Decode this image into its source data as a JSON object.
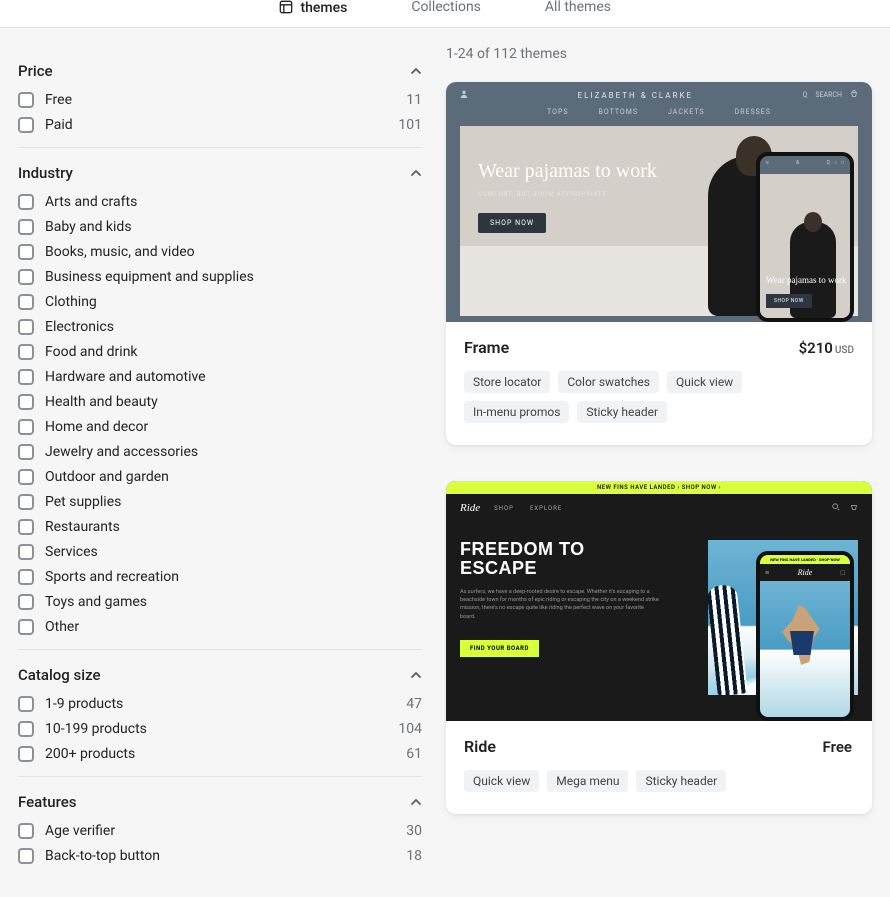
{
  "nav": {
    "themes": "themes",
    "collections": "Collections",
    "all": "All themes"
  },
  "result_count_text": "1-24 of 112 themes",
  "filters": {
    "price": {
      "title": "Price",
      "options": [
        {
          "label": "Free",
          "count": "11"
        },
        {
          "label": "Paid",
          "count": "101"
        }
      ]
    },
    "industry": {
      "title": "Industry",
      "options": [
        {
          "label": "Arts and crafts"
        },
        {
          "label": "Baby and kids"
        },
        {
          "label": "Books, music, and video"
        },
        {
          "label": "Business equipment and supplies"
        },
        {
          "label": "Clothing"
        },
        {
          "label": "Electronics"
        },
        {
          "label": "Food and drink"
        },
        {
          "label": "Hardware and automotive"
        },
        {
          "label": "Health and beauty"
        },
        {
          "label": "Home and decor"
        },
        {
          "label": "Jewelry and accessories"
        },
        {
          "label": "Outdoor and garden"
        },
        {
          "label": "Pet supplies"
        },
        {
          "label": "Restaurants"
        },
        {
          "label": "Services"
        },
        {
          "label": "Sports and recreation"
        },
        {
          "label": "Toys and games"
        },
        {
          "label": "Other"
        }
      ]
    },
    "catalog": {
      "title": "Catalog size",
      "options": [
        {
          "label": "1-9 products",
          "count": "47"
        },
        {
          "label": "10-199 products",
          "count": "104"
        },
        {
          "label": "200+ products",
          "count": "61"
        }
      ]
    },
    "features": {
      "title": "Features",
      "options": [
        {
          "label": "Age verifier",
          "count": "30"
        },
        {
          "label": "Back-to-top button",
          "count": "18"
        }
      ]
    }
  },
  "themes": [
    {
      "name": "Frame",
      "price": "$210",
      "currency": "USD",
      "tags": [
        "Store locator",
        "Color swatches",
        "Quick view",
        "In-menu promos",
        "Sticky header"
      ],
      "preview": {
        "brand": "ELIZABETH & CLARKE",
        "menu": [
          "TOPS",
          "BOTTOMS",
          "JACKETS",
          "DRESSES"
        ],
        "headline": "Wear pajamas to work",
        "sub": "COMFORT, BUT ZOOM APPROPRIATE",
        "cta": "SHOP NOW",
        "mobile_headline": "Wear pajamas to work",
        "mobile_cta": "SHOP NOW",
        "search_label": "SEARCH"
      }
    },
    {
      "name": "Ride",
      "price": "Free",
      "currency": "",
      "tags": [
        "Quick view",
        "Mega menu",
        "Sticky header"
      ],
      "preview": {
        "banner": "NEW FINS HAVE LANDED  ›  SHOP NOW  ›",
        "brand": "Ride",
        "menu": [
          "SHOP",
          "EXPLORE"
        ],
        "headline1": "FREEDOM TO",
        "headline2": "ESCAPE",
        "body": "As surfers, we have a deep-rooted desire to escape. Whether it's escaping to a beachside town for months of epic riding or escaping the city on a weekend strike mission, there's no escape quite like riding the perfect wave on your favorite board.",
        "cta": "FIND YOUR BOARD",
        "mobile_banner": "NEW FINS HAVE LANDED · SHOP NOW"
      }
    }
  ]
}
